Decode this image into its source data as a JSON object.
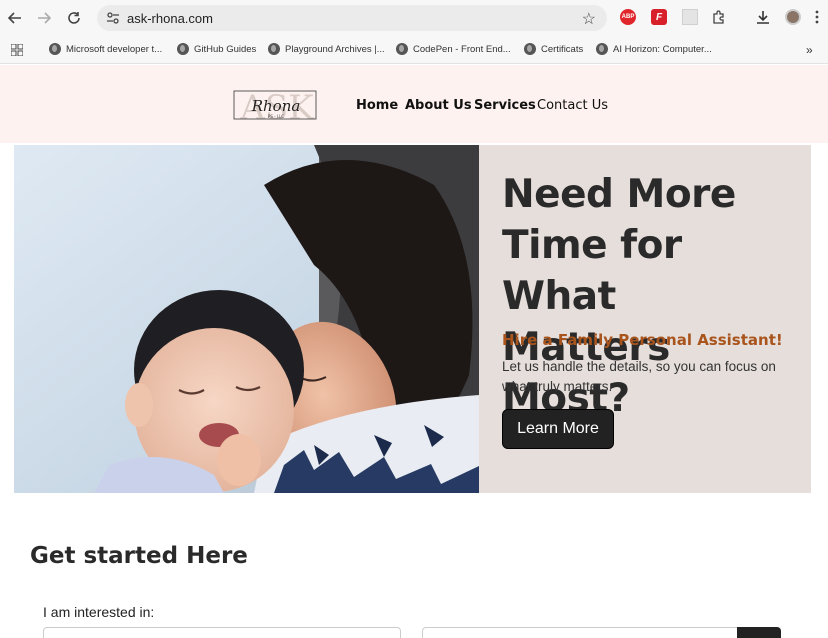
{
  "browser": {
    "url": "ask-rhona.com",
    "bookmarks": [
      "Microsoft developer t...",
      "GitHub Guides",
      "Playground Archives |...",
      "CodePen - Front End...",
      "Certificats",
      "AI Horizon: Computer..."
    ],
    "extensions": [
      "ABP",
      "F"
    ]
  },
  "site": {
    "logo": {
      "big": "ASK",
      "script": "Rhona",
      "small": "PS - LLC"
    },
    "nav": [
      "Home",
      "About Us",
      "Services",
      "Contact Us"
    ],
    "active_nav": "Home",
    "hero": {
      "title_lines": [
        "Need More",
        "Time for What",
        "Matters Most?"
      ],
      "subtitle": "Hire a Family Personal Assistant!",
      "text": "Let us handle the details, so you can focus on what truly matters.",
      "button": "Learn More"
    },
    "form": {
      "title": "Get started Here",
      "interest_label": "I am interested in:"
    }
  },
  "colors": {
    "accent": "#a8541c",
    "header_bg": "#fdf2ef",
    "hero_bg": "#e6dedb",
    "button_bg": "#222222"
  }
}
